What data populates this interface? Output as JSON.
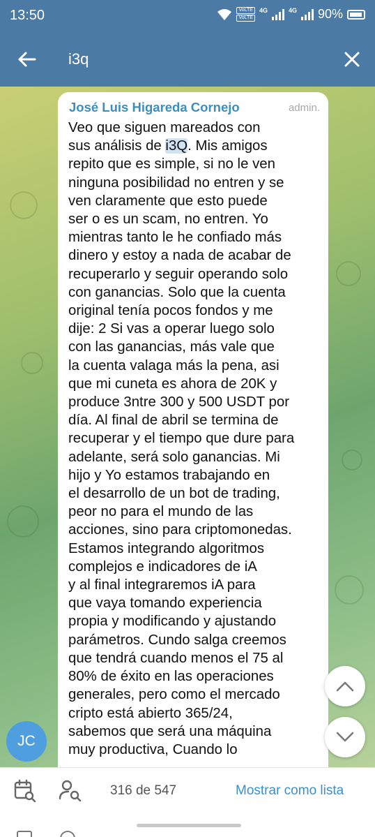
{
  "status": {
    "time": "13:50",
    "volte1": "VoLTE",
    "volte2": "VoLTE",
    "net1": "4G",
    "net2": "4G",
    "battery": "90%"
  },
  "header": {
    "search_value": "i3q"
  },
  "message": {
    "sender": "José Luis Higareda Cornejo",
    "role": "admin.",
    "lines": [
      "Veo que siguen mareados con",
      "sus análisis de ",
      "repito que es simple, si no le ven",
      "ninguna posibilidad no entren y se",
      "ven claramente que esto puede",
      "ser o es un scam, no entren. Yo",
      "mientras tanto le he confiado más",
      "dinero y estoy a nada de acabar de",
      "recuperarlo y seguir operando solo",
      "con ganancias. Solo que la cuenta",
      "original tenía pocos fondos y me",
      "dije: 2 Si vas a operar luego solo",
      "con las ganancias, más vale que",
      "la cuenta valaga más la pena, asi",
      "que mi cuneta es ahora de 20K y",
      "produce 3ntre 300 y 500 USDT por",
      "día. Al final de abril se termina de",
      "recuperar y el tiempo que dure para",
      "adelante, será solo ganancias. Mi",
      "hijo y Yo estamos trabajando en",
      "el desarrollo de un bot de trading,",
      "peor no para el mundo de las",
      "acciones, sino para criptomonedas.",
      "Estamos integrando algoritmos",
      "complejos e indicadores de iA",
      "y al final integraremos iA para",
      "que vaya tomando experiencia",
      "propia y modificando y ajustando",
      "parámetros. Cundo salga creemos",
      "que tendrá cuando menos el 75 al",
      "80% de éxito en las operaciones",
      "generales, pero como el mercado",
      "cripto está abierto 365/24,",
      "sabemos que será una máquina",
      "muy productiva, Cuando lo"
    ],
    "highlight": "i3Q",
    "line2_tail": ". Mis amigos"
  },
  "avatar": {
    "initials": "JC"
  },
  "footer": {
    "counter": "316 de 547",
    "list_button": "Mostrar como lista"
  },
  "colors": {
    "header": "#4b7aa4",
    "sender": "#3a8fbf",
    "accent": "#3a8fcf",
    "highlight": "#cfe3f5",
    "avatar": "#4f9fe0"
  }
}
